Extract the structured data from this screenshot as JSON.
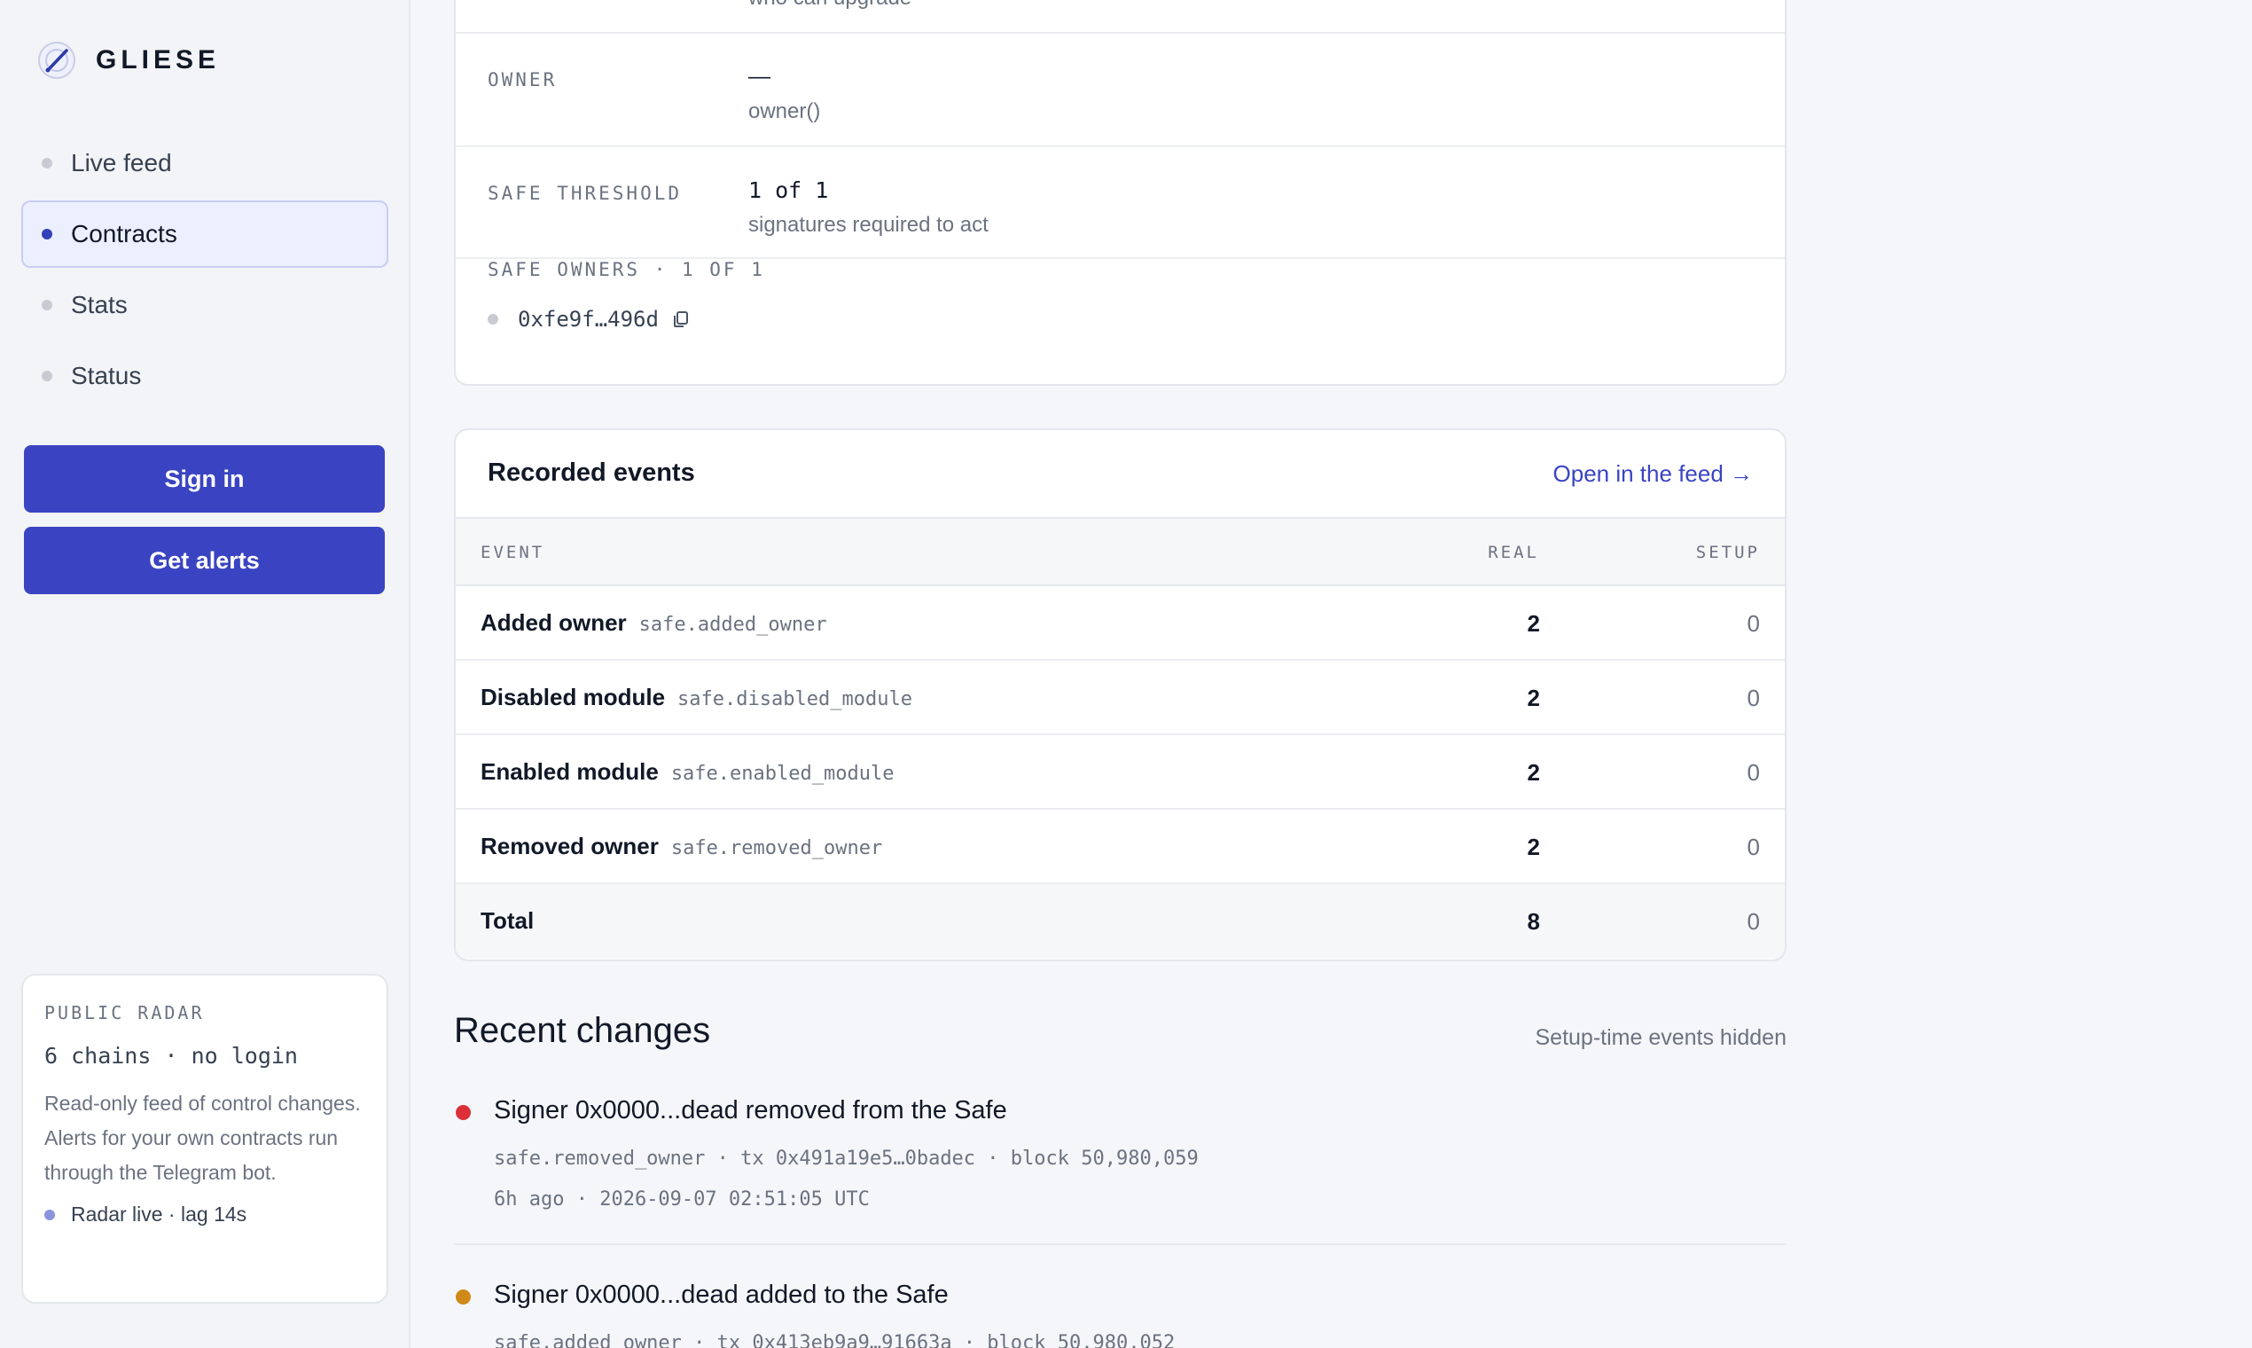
{
  "brand": {
    "name": "GLIESE"
  },
  "nav": [
    {
      "label": "Live feed",
      "active": false
    },
    {
      "label": "Contracts",
      "active": true
    },
    {
      "label": "Stats",
      "active": false
    },
    {
      "label": "Status",
      "active": false
    }
  ],
  "actions": {
    "sign_in": "Sign in",
    "get_alerts": "Get alerts"
  },
  "radar": {
    "title": "PUBLIC RADAR",
    "chains": "6 chains · no login",
    "description": "Read-only feed of control changes. Alerts for your own contracts run through the Telegram bot.",
    "status": "Radar live · lag 14s"
  },
  "properties": {
    "upgrade_sub": "who can upgrade",
    "owner": {
      "label": "OWNER",
      "value": "—",
      "sub": "owner()"
    },
    "threshold": {
      "label": "SAFE THRESHOLD",
      "value": "1 of 1",
      "sub": "signatures required to act"
    },
    "owners": {
      "label": "SAFE OWNERS · 1 OF 1",
      "items": [
        "0xfe9f…496d"
      ]
    }
  },
  "events": {
    "title": "Recorded events",
    "link": "Open in the feed →",
    "columns": {
      "event": "EVENT",
      "real": "REAL",
      "setup": "SETUP"
    },
    "rows": [
      {
        "name": "Added owner",
        "code": "safe.added_owner",
        "real": "2",
        "setup": "0"
      },
      {
        "name": "Disabled module",
        "code": "safe.disabled_module",
        "real": "2",
        "setup": "0"
      },
      {
        "name": "Enabled module",
        "code": "safe.enabled_module",
        "real": "2",
        "setup": "0"
      },
      {
        "name": "Removed owner",
        "code": "safe.removed_owner",
        "real": "2",
        "setup": "0"
      }
    ],
    "total": {
      "name": "Total",
      "real": "8",
      "setup": "0"
    }
  },
  "changes": {
    "title": "Recent changes",
    "note": "Setup-time events hidden",
    "items": [
      {
        "title": "Signer 0x0000...dead removed from the Safe",
        "meta": "safe.removed_owner · tx 0x491a19e5…0badec · block 50,980,059",
        "time": "6h ago · 2026-09-07 02:51:05 UTC",
        "color": "#dc2f3a"
      },
      {
        "title": "Signer 0x0000...dead added to the Safe",
        "meta": "safe.added_owner · tx 0x413eb9a9…91663a · block 50,980,052",
        "color": "#d08a19"
      }
    ]
  }
}
